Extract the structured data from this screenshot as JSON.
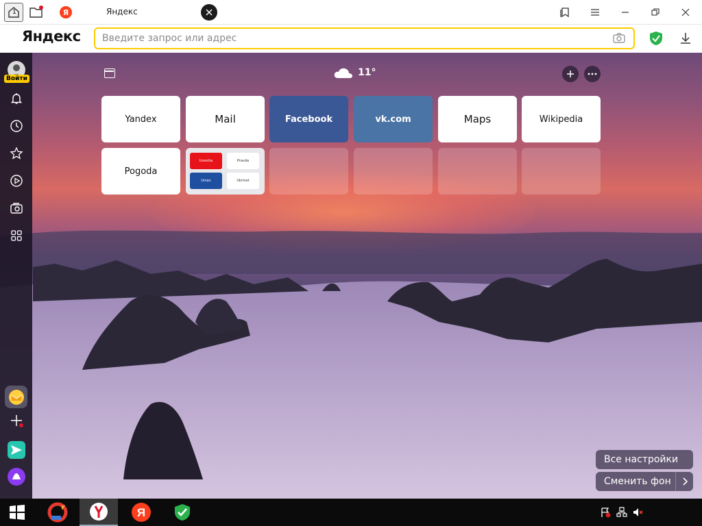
{
  "window": {
    "tab_title": "Яндекс",
    "tab_counter": "1",
    "tab_icon_letter": "Я"
  },
  "address_bar": {
    "logo": "Яндекс",
    "placeholder": "Введите запрос или адрес"
  },
  "sidebar": {
    "login_label": "Войти",
    "items": [
      {
        "name": "notifications",
        "icon": "bell-icon"
      },
      {
        "name": "history",
        "icon": "clock-icon"
      },
      {
        "name": "bookmarks",
        "icon": "star-icon"
      },
      {
        "name": "video",
        "icon": "play-icon"
      },
      {
        "name": "screenshot",
        "icon": "camera-icon"
      },
      {
        "name": "apps",
        "icon": "grid-icon"
      }
    ]
  },
  "weather": {
    "temperature": "11°"
  },
  "tiles": [
    {
      "label": "Yandex",
      "style": "white"
    },
    {
      "label": "Mail",
      "style": "white"
    },
    {
      "label": "Facebook",
      "style": "fb"
    },
    {
      "label": "vk.com",
      "style": "vk"
    },
    {
      "label": "Maps",
      "style": "white"
    },
    {
      "label": "Wikipedia",
      "style": "white"
    },
    {
      "label": "Pogoda",
      "style": "white"
    },
    {
      "label": "",
      "style": "multi",
      "mini": [
        "Izvestia",
        "Pravda",
        "Unian",
        "Ukrinet"
      ]
    },
    {
      "label": "",
      "style": "empty"
    },
    {
      "label": "",
      "style": "empty"
    },
    {
      "label": "",
      "style": "empty"
    },
    {
      "label": "",
      "style": "empty"
    }
  ],
  "bottom_buttons": {
    "all_settings": "Все настройки",
    "change_background": "Сменить фон"
  },
  "colors": {
    "accent_yellow": "#ffcc00",
    "yandex_red": "#fc3f1d",
    "facebook_blue": "#3a5796",
    "vk_blue": "#4a74a5"
  }
}
